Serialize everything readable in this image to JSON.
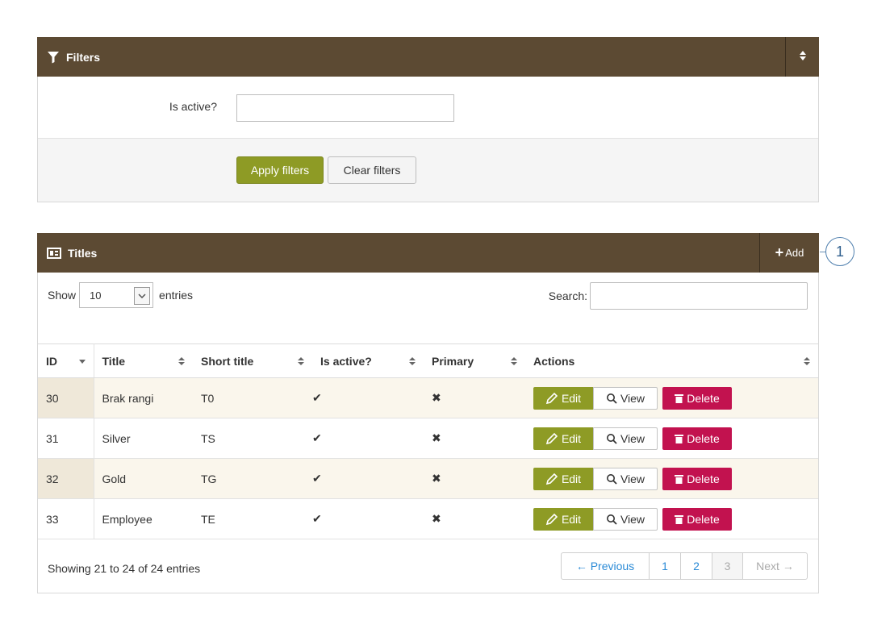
{
  "filters": {
    "title": "Filters",
    "is_active_label": "Is active?",
    "is_active_value": "",
    "apply_label": "Apply filters",
    "clear_label": "Clear filters"
  },
  "titles_panel": {
    "title": "Titles",
    "add_label": "Add",
    "show_label": "Show",
    "entries_label": "entries",
    "page_length": "10",
    "search_label": "Search:",
    "search_value": "",
    "columns": [
      "ID",
      "Title",
      "Short title",
      "Is active?",
      "Primary",
      "Actions"
    ],
    "rows": [
      {
        "id": "30",
        "title": "Brak rangi",
        "short": "T0",
        "active": "✔",
        "primary": "✖"
      },
      {
        "id": "31",
        "title": "Silver",
        "short": "TS",
        "active": "✔",
        "primary": "✖"
      },
      {
        "id": "32",
        "title": "Gold",
        "short": "TG",
        "active": "✔",
        "primary": "✖"
      },
      {
        "id": "33",
        "title": "Employee",
        "short": "TE",
        "active": "✔",
        "primary": "✖"
      }
    ],
    "action_labels": {
      "edit": "Edit",
      "view": "View",
      "delete": "Delete"
    },
    "info": "Showing 21 to 24 of 24 entries",
    "pagination": {
      "prev": "← Previous",
      "pages": [
        "1",
        "2",
        "3"
      ],
      "next": "Next →"
    }
  },
  "callout": "1",
  "colors": {
    "header": "#5c4a33",
    "primary_btn": "#8e9b25",
    "danger_btn": "#c2124f",
    "link": "#2a8ad6"
  }
}
